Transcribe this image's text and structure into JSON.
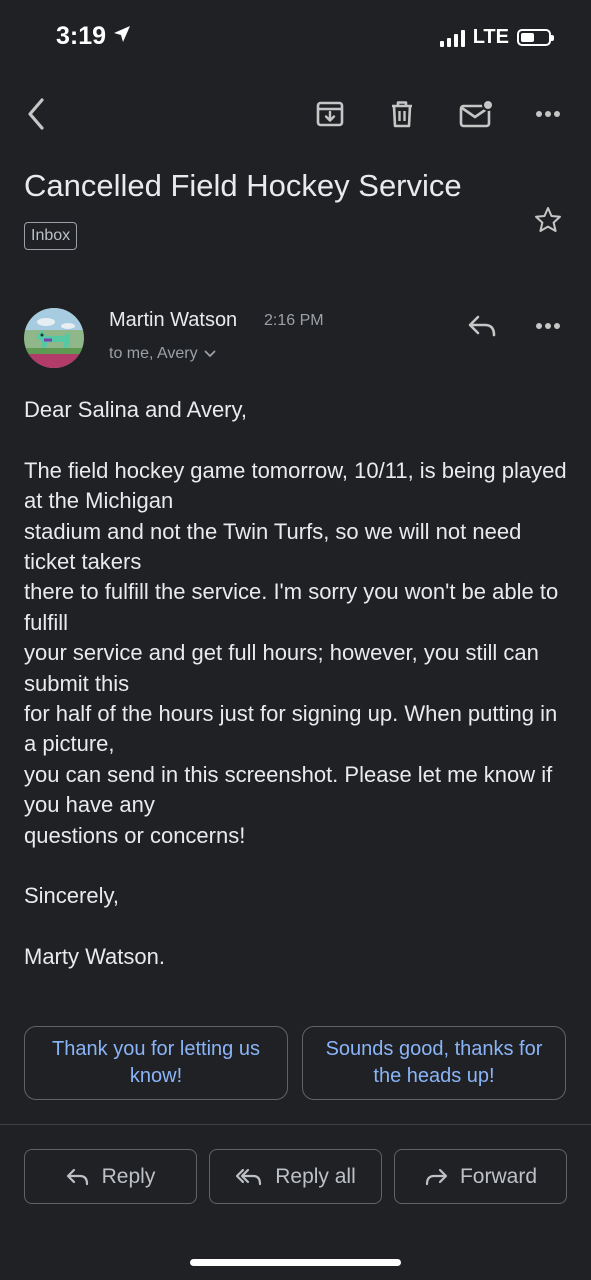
{
  "status_bar": {
    "time": "3:19",
    "network": "LTE",
    "battery_level": 0.5
  },
  "toolbar": {
    "back_icon": "back-arrow-icon",
    "archive_icon": "archive-icon",
    "delete_icon": "trash-icon",
    "unread_icon": "mark-unread-icon",
    "more_icon": "more-vertical-icon"
  },
  "email": {
    "subject": "Cancelled Field Hockey Service",
    "label": "Inbox",
    "sender": {
      "name": "Martin Watson",
      "time": "2:16 PM",
      "recipients": "to me, Avery"
    },
    "body": {
      "greeting": "Dear Salina and Avery,",
      "paragraph_lines": [
        "The field hockey game tomorrow, 10/11, is being played at the Michigan",
        "stadium and not the Twin Turfs, so we will not need ticket takers",
        "there to fulfill the service. I'm sorry you won't be able to fulfill",
        "your service and get full hours; however, you still can submit this",
        "for half of the hours just for signing up. When putting in a picture,",
        "you can send in this screenshot. Please let me know if you have any",
        "questions or concerns!"
      ],
      "closing": "Sincerely,",
      "signature": "Marty Watson."
    }
  },
  "smart_replies": [
    "Thank you for letting us know!",
    "Sounds good, thanks for the heads up!"
  ],
  "actions": {
    "reply": "Reply",
    "reply_all": "Reply all",
    "forward": "Forward"
  },
  "colors": {
    "background": "#202124",
    "text": "#e8eaed",
    "secondary_text": "#9aa0a6",
    "accent": "#8ab4f8"
  }
}
